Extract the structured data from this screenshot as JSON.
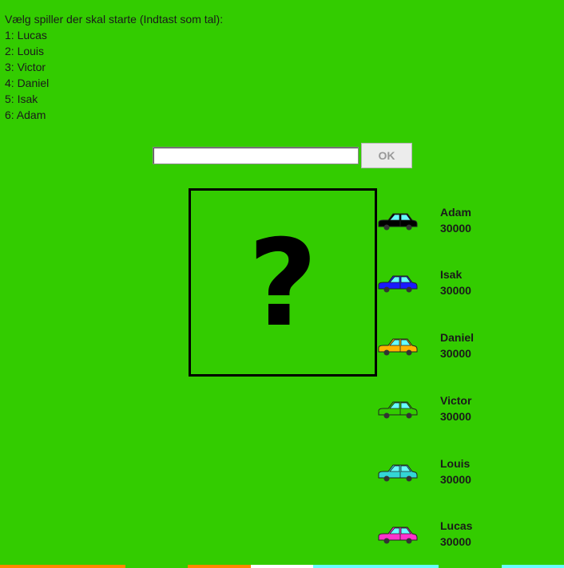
{
  "prompt": {
    "title": "Vælg spiller der skal starte (Indtast som tal):",
    "options": [
      "1: Lucas",
      "2: Louis",
      "3: Victor",
      "4: Daniel",
      "5: Isak",
      "6: Adam"
    ]
  },
  "input": {
    "value": "",
    "placeholder": ""
  },
  "ok_button": {
    "label": "OK"
  },
  "dice": {
    "symbol": "?"
  },
  "players": [
    {
      "name": "Adam",
      "money": "30000",
      "car_color": "#000000"
    },
    {
      "name": "Isak",
      "money": "30000",
      "car_color": "#1a1aff"
    },
    {
      "name": "Daniel",
      "money": "30000",
      "car_color": "#ffb400"
    },
    {
      "name": "Victor",
      "money": "30000",
      "car_color": "#33cc00"
    },
    {
      "name": "Louis",
      "money": "30000",
      "car_color": "#33d6d6"
    },
    {
      "name": "Lucas",
      "money": "30000",
      "car_color": "#ff33cc"
    }
  ],
  "colors": {
    "background": "#33cc00",
    "window": "#66ffff"
  }
}
